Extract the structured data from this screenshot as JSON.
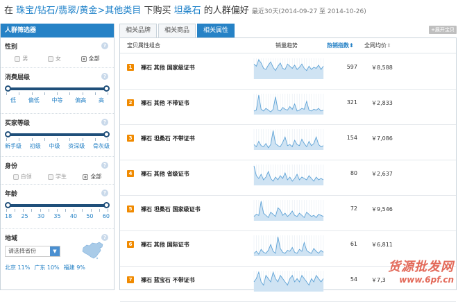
{
  "header": {
    "prefix": "在",
    "breadcrumb": [
      "珠宝",
      "钻石",
      "翡翠",
      "黄金"
    ],
    "category_sep": ">",
    "category": "其他类目",
    "mid": "下购买",
    "keyword": "坦桑石",
    "suffix": "的人群偏好",
    "range": "最近30天(2014-09-27 至 2014-10-26)"
  },
  "sidebar": {
    "title": "人群筛选器",
    "gender": {
      "title": "性别",
      "options": [
        "男",
        "女",
        "全部"
      ],
      "selected": 2
    },
    "consume": {
      "title": "消费层级",
      "labels": [
        "低",
        "偏低",
        "中等",
        "偏高",
        "高"
      ]
    },
    "buyer": {
      "title": "买家等级",
      "labels": [
        "新手级",
        "初级",
        "中级",
        "资深级",
        "骨灰级"
      ]
    },
    "identity": {
      "title": "身份",
      "options": [
        "白领",
        "学生",
        "全部"
      ],
      "selected": 2
    },
    "age": {
      "title": "年龄",
      "labels": [
        "18",
        "25",
        "30",
        "35",
        "40",
        "50",
        "60"
      ]
    },
    "region": {
      "title": "地域",
      "placeholder": "请选择省份",
      "stats": [
        "北京 11%",
        "广东 10%",
        "福建 9%"
      ]
    },
    "help_glyph": "?"
  },
  "tabs": [
    "相关品牌",
    "相关商品",
    "相关属性"
  ],
  "active_tab": 2,
  "expand_label": "+展开宝贝",
  "table": {
    "headers": {
      "attr": "宝贝属性组合",
      "trend": "销量趋势",
      "hot": "热销指数",
      "hot_arrow": "⬍",
      "price": "全网均价",
      "price_arrow": "⬍"
    },
    "rows": [
      {
        "rank": "1",
        "name": "裸石 其他 国家级证书",
        "hot": "597",
        "price": "￥8,588",
        "trend": [
          14,
          12,
          18,
          15,
          10,
          9,
          13,
          16,
          11,
          8,
          12,
          15,
          10,
          9,
          14,
          12,
          10,
          13,
          9,
          11,
          14,
          10,
          8,
          12,
          9,
          11,
          10,
          13,
          9,
          12
        ]
      },
      {
        "rank": "2",
        "name": "裸石 其他 不带证书",
        "hot": "321",
        "price": "￥2,833",
        "trend": [
          4,
          5,
          22,
          6,
          4,
          7,
          5,
          3,
          6,
          20,
          5,
          4,
          8,
          6,
          5,
          9,
          6,
          12,
          4,
          5,
          7,
          6,
          15,
          5,
          4,
          6,
          5,
          7,
          4,
          5
        ]
      },
      {
        "rank": "3",
        "name": "裸石 坦桑石 不带证书",
        "hot": "154",
        "price": "￥7,086",
        "trend": [
          5,
          3,
          8,
          4,
          3,
          6,
          2,
          5,
          18,
          6,
          4,
          3,
          7,
          12,
          4,
          5,
          3,
          9,
          5,
          4,
          10,
          6,
          3,
          8,
          4,
          6,
          12,
          5,
          3,
          4
        ]
      },
      {
        "rank": "4",
        "name": "裸石 其他 省级证书",
        "hot": "80",
        "price": "￥2,637",
        "trend": [
          14,
          7,
          5,
          8,
          4,
          6,
          10,
          5,
          3,
          6,
          4,
          7,
          5,
          9,
          4,
          6,
          3,
          5,
          8,
          4,
          6,
          5,
          4,
          7,
          5,
          3,
          6,
          4,
          5,
          4
        ]
      },
      {
        "rank": "5",
        "name": "裸石 坦桑石 国家级证书",
        "hot": "72",
        "price": "￥9,546",
        "trend": [
          4,
          6,
          5,
          18,
          7,
          5,
          3,
          8,
          6,
          4,
          12,
          10,
          5,
          7,
          4,
          6,
          9,
          5,
          4,
          7,
          5,
          3,
          8,
          6,
          4,
          5,
          3,
          6,
          5,
          4
        ]
      },
      {
        "rank": "6",
        "name": "裸石 其他 国际证书",
        "hot": "61",
        "price": "￥6,811",
        "trend": [
          3,
          5,
          2,
          7,
          4,
          3,
          6,
          12,
          5,
          3,
          20,
          8,
          4,
          3,
          6,
          5,
          9,
          4,
          3,
          7,
          5,
          14,
          6,
          4,
          3,
          8,
          5,
          3,
          6,
          4
        ]
      },
      {
        "rank": "7",
        "name": "裸石 蓝宝石 不带证书",
        "hot": "54",
        "price": "￥7,3",
        "trend": [
          3,
          4,
          6,
          3,
          2,
          5,
          4,
          3,
          6,
          4,
          3,
          5,
          4,
          3,
          2,
          4,
          5,
          3,
          4,
          3,
          5,
          4,
          3,
          2,
          4,
          3,
          5,
          4,
          3,
          4
        ]
      }
    ]
  },
  "watermark": {
    "cn": "货源批发网",
    "url": "www.6pf.cn"
  },
  "colors": {
    "accent": "#2682c6",
    "rank": "#f08a00",
    "spark_line": "#5fa3d6",
    "spark_fill": "#cfe3f3",
    "watermark": "#e36a5a"
  }
}
